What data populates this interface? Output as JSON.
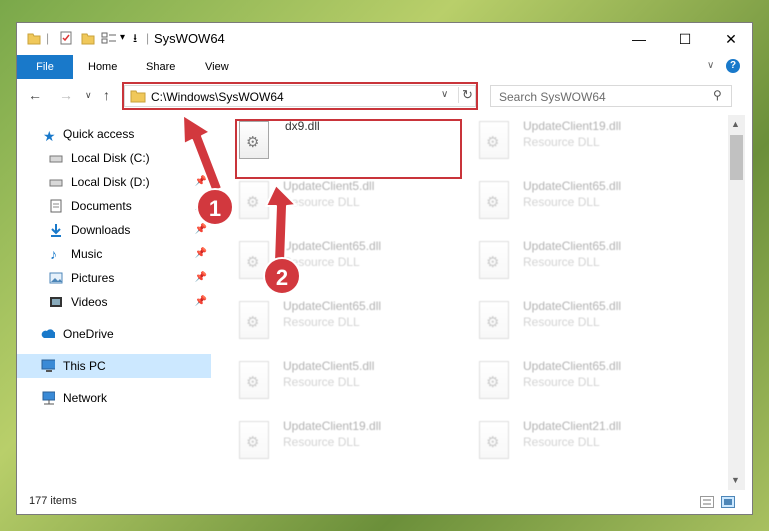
{
  "window": {
    "title": "SysWOW64",
    "quick_access_dropdown": "▾"
  },
  "ribbon": {
    "tabs": [
      "File",
      "Home",
      "Share",
      "View"
    ]
  },
  "navbar": {
    "address": "C:\\Windows\\SysWOW64",
    "search_placeholder": "Search SysWOW64"
  },
  "sidebar": {
    "items": [
      {
        "label": "Quick access",
        "icon": "star-icon",
        "pinned": false
      },
      {
        "label": "Local Disk (C:)",
        "icon": "drive-icon",
        "pinned": true
      },
      {
        "label": "Local Disk (D:)",
        "icon": "drive-icon",
        "pinned": true
      },
      {
        "label": "Documents",
        "icon": "documents-icon",
        "pinned": true
      },
      {
        "label": "Downloads",
        "icon": "download-icon",
        "pinned": true
      },
      {
        "label": "Music",
        "icon": "music-icon",
        "pinned": true
      },
      {
        "label": "Pictures",
        "icon": "pictures-icon",
        "pinned": true
      },
      {
        "label": "Videos",
        "icon": "videos-icon",
        "pinned": true
      },
      {
        "label": "OneDrive",
        "icon": "cloud-icon",
        "pinned": false
      },
      {
        "label": "This PC",
        "icon": "computer-icon",
        "pinned": false,
        "selected": true
      },
      {
        "label": "Network",
        "icon": "network-icon",
        "pinned": false
      }
    ]
  },
  "files": [
    {
      "name": "dx9.dll",
      "type": "",
      "highlighted": true
    },
    {
      "name": "UpdateClient19.dll",
      "type": "Resource DLL"
    },
    {
      "name": "UpdateClient5.dll",
      "type": "Resource DLL"
    },
    {
      "name": "UpdateClient65.dll",
      "type": "Resource DLL"
    },
    {
      "name": "UpdateClient65.dll",
      "type": "Resource DLL"
    },
    {
      "name": "UpdateClient65.dll",
      "type": "Resource DLL"
    },
    {
      "name": "UpdateClient65.dll",
      "type": "Resource DLL"
    },
    {
      "name": "UpdateClient65.dll",
      "type": "Resource DLL"
    },
    {
      "name": "UpdateClient5.dll",
      "type": "Resource DLL"
    },
    {
      "name": "UpdateClient65.dll",
      "type": "Resource DLL"
    },
    {
      "name": "UpdateClient19.dll",
      "type": "Resource DLL"
    },
    {
      "name": "UpdateClient21.dll",
      "type": "Resource DLL"
    }
  ],
  "status": {
    "item_count": "177 items"
  },
  "callouts": [
    "1",
    "2"
  ],
  "colors": {
    "accent": "#1979ca",
    "highlight": "#c9343a",
    "callout": "#d2383e",
    "selected": "#cce8ff"
  }
}
